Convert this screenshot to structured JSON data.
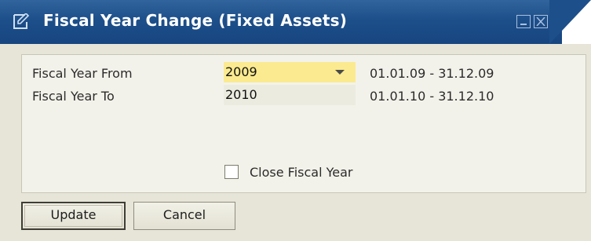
{
  "window": {
    "title": "Fiscal Year Change (Fixed Assets)",
    "icons": [
      "form-icon",
      "minimize-icon",
      "close-icon"
    ]
  },
  "form": {
    "fiscal_year_from": {
      "label": "Fiscal Year From",
      "value": "2009",
      "range": "01.01.09 - 31.12.09"
    },
    "fiscal_year_to": {
      "label": "Fiscal Year To",
      "value": "2010",
      "range": "01.01.10 - 31.12.10"
    },
    "close_fiscal_year": {
      "label": "Close Fiscal Year",
      "checked": false
    }
  },
  "buttons": {
    "update": "Update",
    "cancel": "Cancel"
  },
  "colors": {
    "titlebar": "#1d4f8a",
    "body": "#e6e5d8",
    "focused_field": "#fbea90"
  }
}
